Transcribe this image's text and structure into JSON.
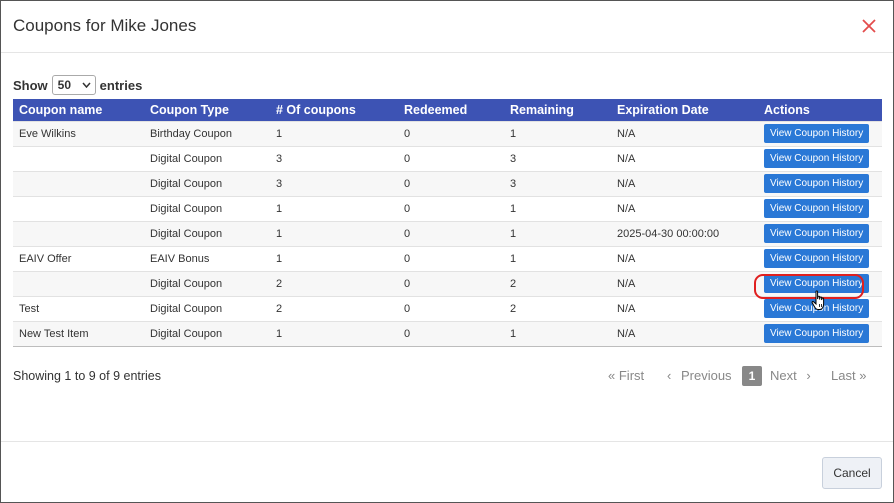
{
  "modal": {
    "title": "Coupons for Mike Jones",
    "close_icon": "close-icon",
    "accent_color": "#e34c4c"
  },
  "length_menu": {
    "prefix": "Show",
    "selected": "50",
    "suffix": "entries"
  },
  "table": {
    "header_color": "#3d53b4",
    "columns": [
      "Coupon name",
      "Coupon Type",
      "# Of coupons",
      "Redeemed",
      "Remaining",
      "Expiration Date",
      "Actions"
    ],
    "rows": [
      {
        "name": "Eve Wilkins",
        "type": "Birthday Coupon",
        "count": "1",
        "redeemed": "0",
        "remaining": "1",
        "expiration": "N/A",
        "action": "View Coupon History"
      },
      {
        "name": "",
        "type": "Digital Coupon",
        "count": "3",
        "redeemed": "0",
        "remaining": "3",
        "expiration": "N/A",
        "action": "View Coupon History"
      },
      {
        "name": "",
        "type": "Digital Coupon",
        "count": "3",
        "redeemed": "0",
        "remaining": "3",
        "expiration": "N/A",
        "action": "View Coupon History"
      },
      {
        "name": "",
        "type": "Digital Coupon",
        "count": "1",
        "redeemed": "0",
        "remaining": "1",
        "expiration": "N/A",
        "action": "View Coupon History"
      },
      {
        "name": "",
        "type": "Digital Coupon",
        "count": "1",
        "redeemed": "0",
        "remaining": "1",
        "expiration": "2025-04-30 00:00:00",
        "action": "View Coupon History"
      },
      {
        "name": "EAIV Offer",
        "type": "EAIV Bonus",
        "count": "1",
        "redeemed": "0",
        "remaining": "1",
        "expiration": "N/A",
        "action": "View Coupon History"
      },
      {
        "name": "",
        "type": "Digital Coupon",
        "count": "2",
        "redeemed": "0",
        "remaining": "2",
        "expiration": "N/A",
        "action": "View Coupon History"
      },
      {
        "name": "Test",
        "type": "Digital Coupon",
        "count": "2",
        "redeemed": "0",
        "remaining": "2",
        "expiration": "N/A",
        "action": "View Coupon History"
      },
      {
        "name": "New Test Item",
        "type": "Digital Coupon",
        "count": "1",
        "redeemed": "0",
        "remaining": "1",
        "expiration": "N/A",
        "action": "View Coupon History"
      }
    ],
    "action_button_color": "#2a78d6",
    "highlighted_row": 7
  },
  "info": "Showing 1 to 9 of 9 entries",
  "pagination": {
    "first": "First",
    "previous": "Previous",
    "current": "1",
    "next": "Next",
    "last": "Last"
  },
  "footer": {
    "cancel_label": "Cancel"
  }
}
